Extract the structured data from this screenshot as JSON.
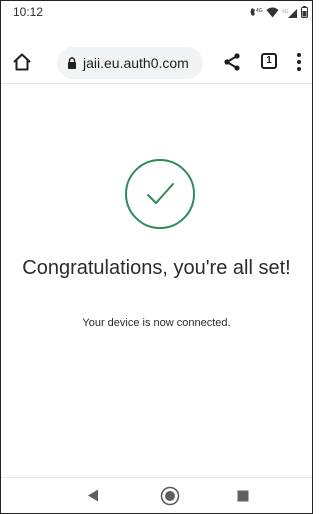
{
  "status_bar": {
    "time": "10:12",
    "icons": [
      "volte-icon",
      "wifi-icon",
      "4g-signal-icon",
      "battery-icon"
    ]
  },
  "browser": {
    "url": "jaii.eu.auth0.com",
    "tab_count": "1",
    "icons": [
      "home-icon",
      "lock-icon",
      "share-icon",
      "tabs-icon",
      "more-vert-icon"
    ]
  },
  "page": {
    "headline": "Congratulations, you're all set!",
    "subtext": "Your device is now connected.",
    "accent_color": "#2e8b57"
  },
  "nav_bar": {
    "icons": [
      "back-triangle-icon",
      "home-circle-icon",
      "recents-square-icon"
    ]
  }
}
